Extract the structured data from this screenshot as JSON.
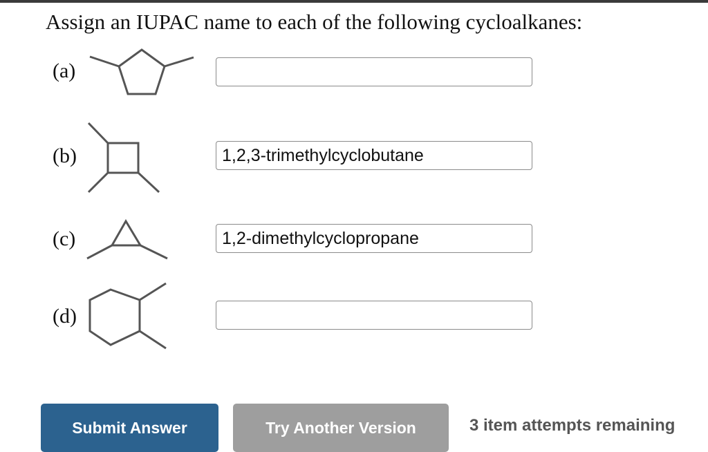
{
  "question": {
    "prompt": "Assign an IUPAC name to each of the following cycloalkanes:"
  },
  "items": [
    {
      "label": "(a)",
      "structure_icon": "methylcyclopentane-structure-icon",
      "answer": ""
    },
    {
      "label": "(b)",
      "structure_icon": "trimethylcyclobutane-structure-icon",
      "answer": "1,2,3-trimethylcyclobutane"
    },
    {
      "label": "(c)",
      "structure_icon": "dimethylcyclopropane-structure-icon",
      "answer": "1,2-dimethylcyclopropane"
    },
    {
      "label": "(d)",
      "structure_icon": "dimethylcyclohexane-structure-icon",
      "answer": ""
    }
  ],
  "actions": {
    "submit_label": "Submit Answer",
    "try_another_label": "Try Another Version",
    "attempts_text": "3 item attempts remaining"
  },
  "colors": {
    "submit_bg": "#2c628f",
    "try_another_bg": "#9e9e9e",
    "structure_stroke": "#555555",
    "input_border": "#8a8a8a"
  }
}
